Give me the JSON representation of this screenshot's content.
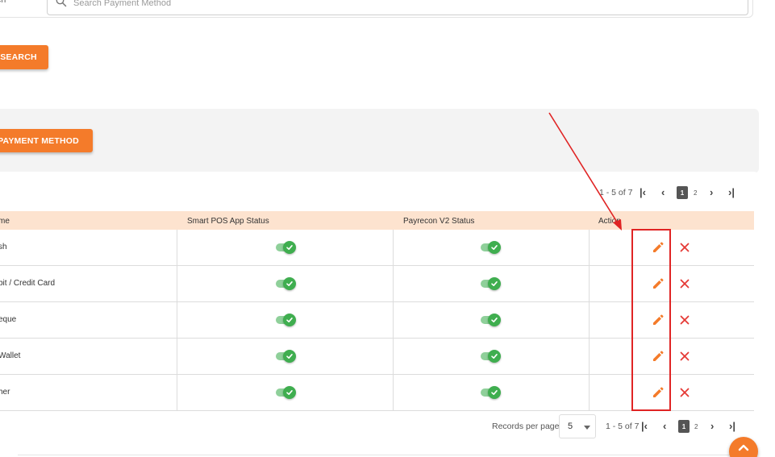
{
  "search": {
    "label": "arch",
    "placeholder": "Search Payment Method",
    "button_label": "SEARCH"
  },
  "toolbar": {
    "add_button_label": "PAYMENT METHOD"
  },
  "pagination_top": {
    "range_text": "1 - 5 of 7",
    "active_page": "1",
    "next_page": "2"
  },
  "table": {
    "columns": {
      "name": "me",
      "smart_pos": "Smart POS App Status",
      "payrecon": "Payrecon V2 Status",
      "action": "Action"
    },
    "rows": [
      {
        "name": "sh",
        "smart_pos_enabled": true,
        "payrecon_enabled": true
      },
      {
        "name": "bit / Credit Card",
        "smart_pos_enabled": true,
        "payrecon_enabled": true
      },
      {
        "name": "eque",
        "smart_pos_enabled": true,
        "payrecon_enabled": true
      },
      {
        "name": "Wallet",
        "smart_pos_enabled": true,
        "payrecon_enabled": true
      },
      {
        "name": "her",
        "smart_pos_enabled": true,
        "payrecon_enabled": true
      }
    ]
  },
  "pagination_bottom": {
    "records_per_page_label": "Records per page",
    "records_per_page_value": "5",
    "range_text": "1 - 5 of 7",
    "active_page": "1",
    "next_page": "2"
  },
  "icons": {
    "search": "search-icon",
    "edit": "pencil-icon",
    "delete": "close-icon",
    "first_page": "first-page-icon",
    "prev_page": "chevron-left-icon",
    "next_page": "chevron-right-icon",
    "last_page": "last-page-icon",
    "scroll_top": "chevron-up-icon",
    "annotation": "red-arrow-annotation"
  },
  "colors": {
    "brand_orange": "#f47b2a",
    "header_bg": "#fde3cf",
    "toggle_on": "#3fae4f",
    "delete_red": "#e53935",
    "annotation_red": "#e02424"
  }
}
